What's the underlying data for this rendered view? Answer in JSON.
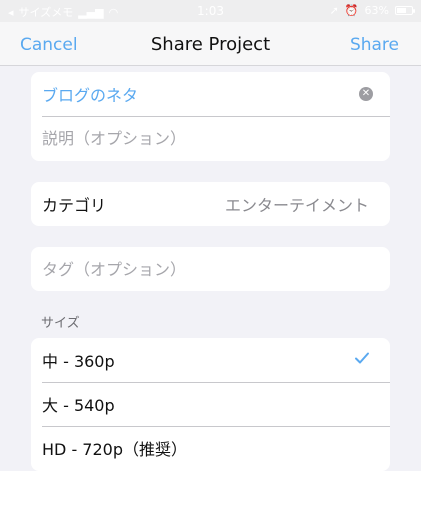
{
  "status_bar": {
    "carrier": "サイズメモ",
    "time": "1:03",
    "battery_percent": "63%"
  },
  "nav": {
    "cancel_label": "Cancel",
    "title": "Share Project",
    "share_label": "Share"
  },
  "form": {
    "title_value": "ブログのネタ",
    "description_placeholder": "説明（オプション）",
    "category_label": "カテゴリ",
    "category_value": "エンターテイメント",
    "tag_placeholder": "タグ（オプション）"
  },
  "size_section": {
    "label": "サイズ",
    "options": [
      {
        "label": "中 - 360p",
        "selected": true
      },
      {
        "label": "大 - 540p",
        "selected": false
      },
      {
        "label": "HD - 720p（推奨）",
        "selected": false
      }
    ]
  },
  "colors": {
    "accent": "#5aa9f0",
    "background": "#f2f2f7"
  }
}
